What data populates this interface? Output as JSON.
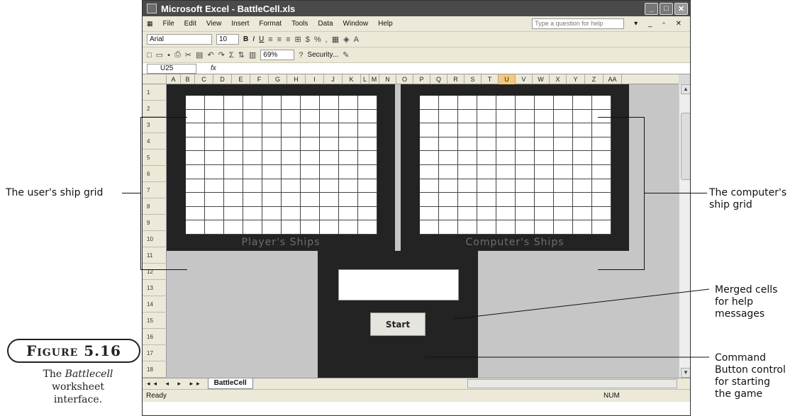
{
  "window": {
    "title": "Microsoft Excel - BattleCell.xls",
    "controls": [
      "_",
      "□",
      "✕"
    ]
  },
  "menu": {
    "items": [
      "File",
      "Edit",
      "View",
      "Insert",
      "Format",
      "Tools",
      "Data",
      "Window",
      "Help"
    ],
    "ask_placeholder": "Type a question for help"
  },
  "format_toolbar": {
    "font": "Arial",
    "size": "10",
    "bold": "B",
    "italic": "I",
    "underline": "U"
  },
  "std_toolbar": {
    "zoom": "69%",
    "security": "Security..."
  },
  "formula_bar": {
    "name_box": "U25",
    "fx": "fx"
  },
  "columns": [
    "A",
    "B",
    "C",
    "D",
    "E",
    "F",
    "G",
    "H",
    "I",
    "J",
    "K",
    "L",
    "M",
    "N",
    "O",
    "P",
    "Q",
    "R",
    "S",
    "T",
    "U",
    "V",
    "W",
    "X",
    "Y",
    "Z",
    "AA"
  ],
  "selected_column": "U",
  "rows": [
    "1",
    "2",
    "3",
    "4",
    "5",
    "6",
    "7",
    "8",
    "9",
    "10",
    "11",
    "12",
    "13",
    "14",
    "15",
    "16",
    "17",
    "18"
  ],
  "player_board": {
    "label": "Player's Ships"
  },
  "computer_board": {
    "label": "Computer's Ships"
  },
  "start_button": {
    "label": "Start"
  },
  "sheet_tab": {
    "name": "BattleCell"
  },
  "status": {
    "ready": "Ready",
    "num": "NUM"
  },
  "annotations": {
    "user_grid": "The user's ship grid",
    "computer_grid_1": "The computer's",
    "computer_grid_2": "ship grid",
    "help_1": "Merged cells",
    "help_2": "for help",
    "help_3": "messages",
    "cmd_1": "Command",
    "cmd_2": "Button control",
    "cmd_3": "for starting",
    "cmd_4": "the game"
  },
  "figure": {
    "badge": "Figure 5.16",
    "caption_1": "The",
    "caption_italic": "Battlecell",
    "caption_2": "worksheet",
    "caption_3": "interface."
  }
}
